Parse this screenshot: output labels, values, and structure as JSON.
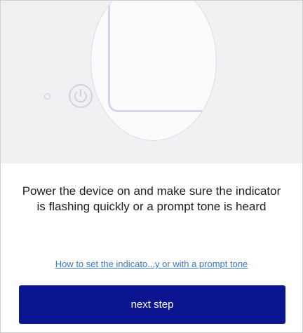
{
  "illustration": {
    "device": "smart-device-corner",
    "indicator_icon": "indicator-light-icon",
    "power_icon": "power-icon",
    "colors": {
      "background": "#f1f1f3",
      "circle": "#fbfbfd",
      "outline": "#d2d5e6"
    }
  },
  "instruction": {
    "text": "Power the device on and make sure the indicator is flashing quickly or a prompt tone is heard"
  },
  "help_link": {
    "label": "How to set the indicato...y or with a  prompt tone",
    "color": "#3a78c8"
  },
  "next_button": {
    "label": "next step",
    "color": "#0b1590"
  }
}
